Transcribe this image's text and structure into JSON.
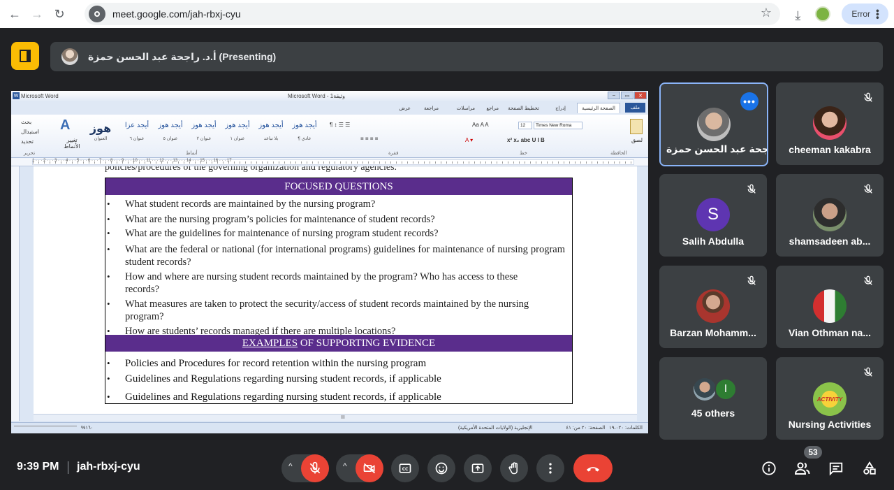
{
  "browser": {
    "url": "meet.google.com/jah-rbxj-cyu",
    "error_label": "Error"
  },
  "presenting_bar": {
    "text": "أ.د. راجحة عبد الحسن حمزة (Presenting)"
  },
  "word": {
    "app_title": "Microsoft Word",
    "title_center": "Microsoft Word - وثيقة1",
    "file_tab": "ملف",
    "tabs": [
      "الصفحة الرئيسية",
      "إدراج",
      "تخطيط الصفحة",
      "مراجع",
      "مراسلات",
      "مراجعة",
      "عرض"
    ],
    "styles": [
      {
        "sample": "أيجد هوز",
        "name": "¶ عادي"
      },
      {
        "sample": "أيجد هوز",
        "name": "بلا تباعد"
      },
      {
        "sample": "أيجد هوز",
        "name": "عنوان ١"
      },
      {
        "sample": "أيجد هوز",
        "name": "عنوان ٢"
      },
      {
        "sample": "أيجد هوز",
        "name": "عنوان ٥"
      },
      {
        "sample": "أيجد عزا",
        "name": "عنوان ٦"
      },
      {
        "sample": "هوز",
        "name": "العنوان"
      }
    ],
    "font_name": "Times New Roma",
    "font_size": "12",
    "group_labels": {
      "clipboard": "الحافظة",
      "font": "خط",
      "paragraph": "فقرة",
      "styles": "أنماط",
      "editing": "تحرير"
    },
    "paste_label": "لصق",
    "change_styles": "تغيير الأنماط",
    "editing_items": [
      "بحث",
      "استبدال",
      "تحديد"
    ],
    "clipped_text": "policies/procedures of the governing organization and regulatory agencies.",
    "focused_title": "FOCUSED QUESTIONS",
    "questions": [
      "What student records are maintained by the nursing program?",
      "What are the nursing program’s policies for maintenance of student records?",
      "What are the guidelines for maintenance of nursing program student records?",
      "What are the federal or national (for international programs) guidelines for maintenance of nursing program student records?",
      "How and where are nursing student records maintained by the program? Who has access to these records?",
      "What measures are taken to protect the security/access of student records maintained by the nursing program?",
      "How are students’ records managed if there are multiple locations?"
    ],
    "evidence_title_underlined": "EXAMPLES",
    "evidence_title_rest": " OF SUPPORTING EVIDENCE",
    "evidence": [
      "Policies and Procedures for record retention within the nursing program",
      "Guidelines and Regulations regarding nursing student records, if applicable",
      "Guidelines and Regulations regarding nursing student records, if applicable"
    ],
    "status_page": "الصفحة: ٢٠ من: ٤١",
    "status_words": "الكلمات: ١٩،٠٢٠",
    "status_lang": "الإنجليزية (الولايات المتحدة الأمريكية)",
    "zoom": "%١٦٠"
  },
  "participants": [
    {
      "name": "راجحة عبد الحسن حمزة...",
      "more": "•••"
    },
    {
      "name": "cheeman kakabra"
    },
    {
      "name": "Salih Abdulla",
      "initial": "S"
    },
    {
      "name": "shamsadeen ab..."
    },
    {
      "name": "Barzan Mohamm..."
    },
    {
      "name": "Vian Othman na..."
    },
    {
      "name": "45 others",
      "initial": "I"
    },
    {
      "name": "Nursing Activities",
      "logo_text": "ACTIVITY"
    }
  ],
  "bottom": {
    "time": "9:39 PM",
    "meeting_code": "jah-rbxj-cyu",
    "people_count": "53"
  },
  "colors": {
    "meet_bg": "#202124",
    "tile_bg": "#3c4043",
    "red": "#ea4335",
    "table_header": "#5a2d8c",
    "presenting": "#fbbc04"
  }
}
